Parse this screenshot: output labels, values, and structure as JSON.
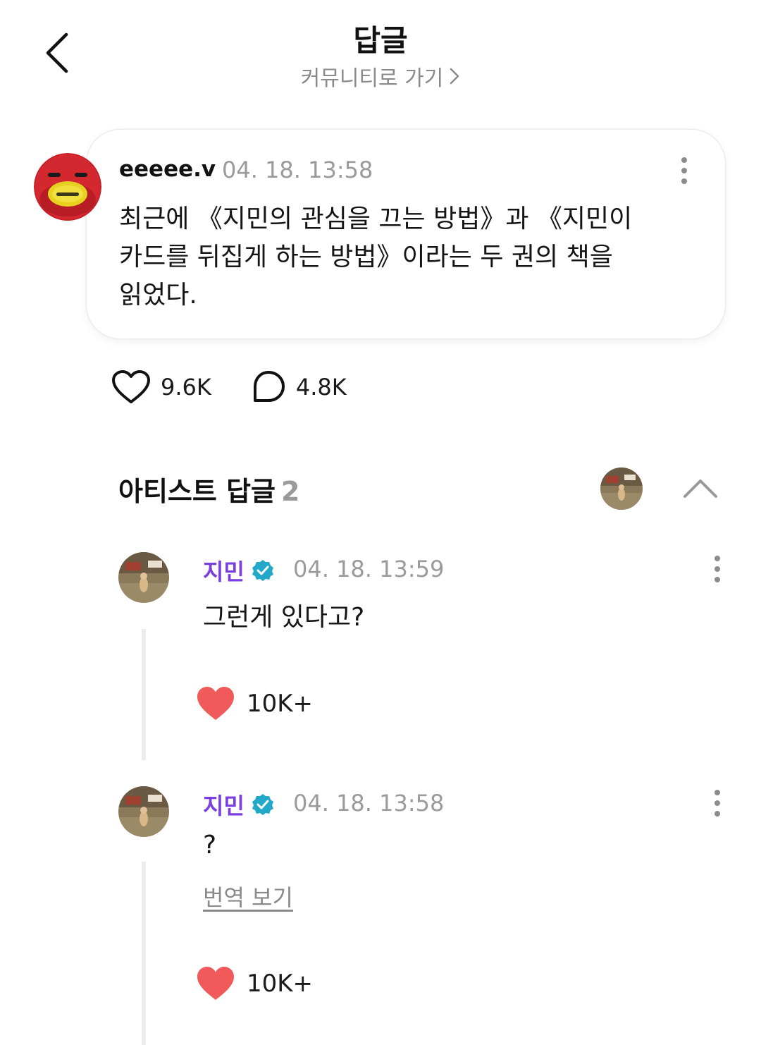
{
  "header": {
    "title": "답글",
    "subtitle": "커뮤니티로 가기"
  },
  "post": {
    "author": "eeeee.v",
    "timestamp": "04. 18. 13:58",
    "text_lines": [
      "최근에 《지민의 관심을 끄는 방법》과 《지민이",
      "카드를 뒤집게 하는 방법》이라는 두 권의 책을",
      "읽었다."
    ],
    "likes": "9.6K",
    "comments": "4.8K"
  },
  "artist_replies": {
    "title": "아티스트 답글",
    "count": "2",
    "items": [
      {
        "author": "지민",
        "timestamp": "04. 18. 13:59",
        "text": "그런게 있다고?",
        "likes": "10K+"
      },
      {
        "author": "지민",
        "timestamp": "04. 18. 13:58",
        "text": "?",
        "translate_label": "번역 보기",
        "likes": "10K+"
      }
    ]
  },
  "colors": {
    "artist_name": "#7a3fe0",
    "verified_badge": "#22a8c8",
    "liked_heart": "#f05a5a"
  },
  "icons": [
    "back-arrow-icon",
    "chevron-right-icon",
    "more-vertical-icon",
    "heart-outline-icon",
    "comment-bubble-icon",
    "chevron-up-icon",
    "verified-badge-icon",
    "heart-filled-icon"
  ]
}
